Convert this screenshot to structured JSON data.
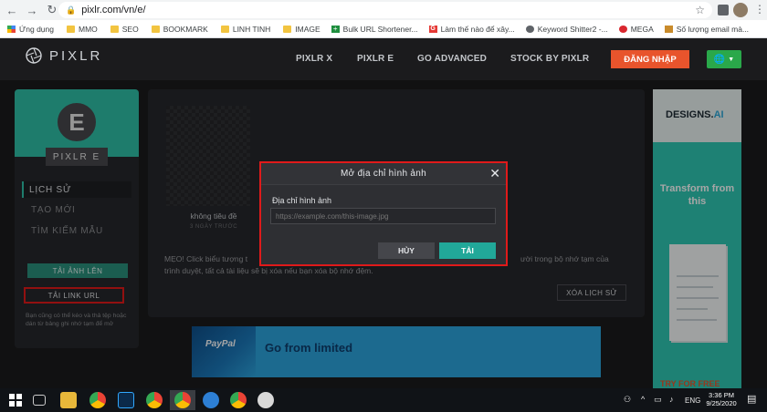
{
  "browser": {
    "url": "pixlr.com/vn/e/",
    "bookmarks": [
      {
        "label": "Ứng dụng",
        "icon": "apps-icon"
      },
      {
        "label": "MMO",
        "icon": "folder-icon"
      },
      {
        "label": "SEO",
        "icon": "folder-icon"
      },
      {
        "label": "BOOKMARK",
        "icon": "folder-icon"
      },
      {
        "label": "LINH TINH",
        "icon": "folder-icon"
      },
      {
        "label": "IMAGE",
        "icon": "folder-icon"
      },
      {
        "label": "Bulk URL Shortener...",
        "icon": "plus-icon"
      },
      {
        "label": "Làm thế nào để xây...",
        "icon": "g-icon"
      },
      {
        "label": "Keyword Shitter2 -...",
        "icon": "globe-icon"
      },
      {
        "label": "MEGA",
        "icon": "mega-icon"
      },
      {
        "label": "Số lượng email mà...",
        "icon": "pen-icon"
      }
    ]
  },
  "header": {
    "logo": "PIXLR",
    "nav": [
      "PIXLR X",
      "PIXLR E",
      "GO ADVANCED",
      "STOCK BY PIXLR"
    ],
    "login": "ĐĂNG NHẬP",
    "lang_icon": "globe-icon"
  },
  "sidebar": {
    "badge": "E",
    "app_name": "PIXLR E",
    "menu": [
      "LỊCH SỬ",
      "TẠO MỚI",
      "TÌM KIẾM MẪU"
    ],
    "upload": "TẢI ẢNH LÊN",
    "upload_url": "TẢI LINK URL",
    "hint": "Bạn cũng có thể kéo và thả tệp hoặc dán từ bảng ghi nhớ tạm để mở"
  },
  "history": {
    "item_title": "không tiêu đề",
    "item_date": "3 NGÀY TRƯỚC",
    "tip_line1": "MẸO! Click biểu tượng t",
    "tip_line1_end": "ười trong bộ nhớ tạm của",
    "tip_line2": "trình duyệt, tất cả tài liệu sẽ bị xóa nếu bạn xóa bộ nhớ đệm.",
    "clear": "XÓA LỊCH SỬ"
  },
  "banner": {
    "brand": "PayPal",
    "text": "Go from limited"
  },
  "right_ad": {
    "logo": "DESIGNS.",
    "logo_accent": "AI",
    "headline": "Transform from this",
    "cta": "TRY FOR FREE"
  },
  "modal": {
    "title": "Mở địa chỉ hình ảnh",
    "field_label": "Địa chỉ hình ảnh",
    "placeholder": "https://example.com/this-image.jpg",
    "cancel": "HỦY",
    "ok": "TẢI"
  },
  "taskbar": {
    "lang": "ENG",
    "time": "3:36 PM",
    "date": "9/25/2020"
  }
}
